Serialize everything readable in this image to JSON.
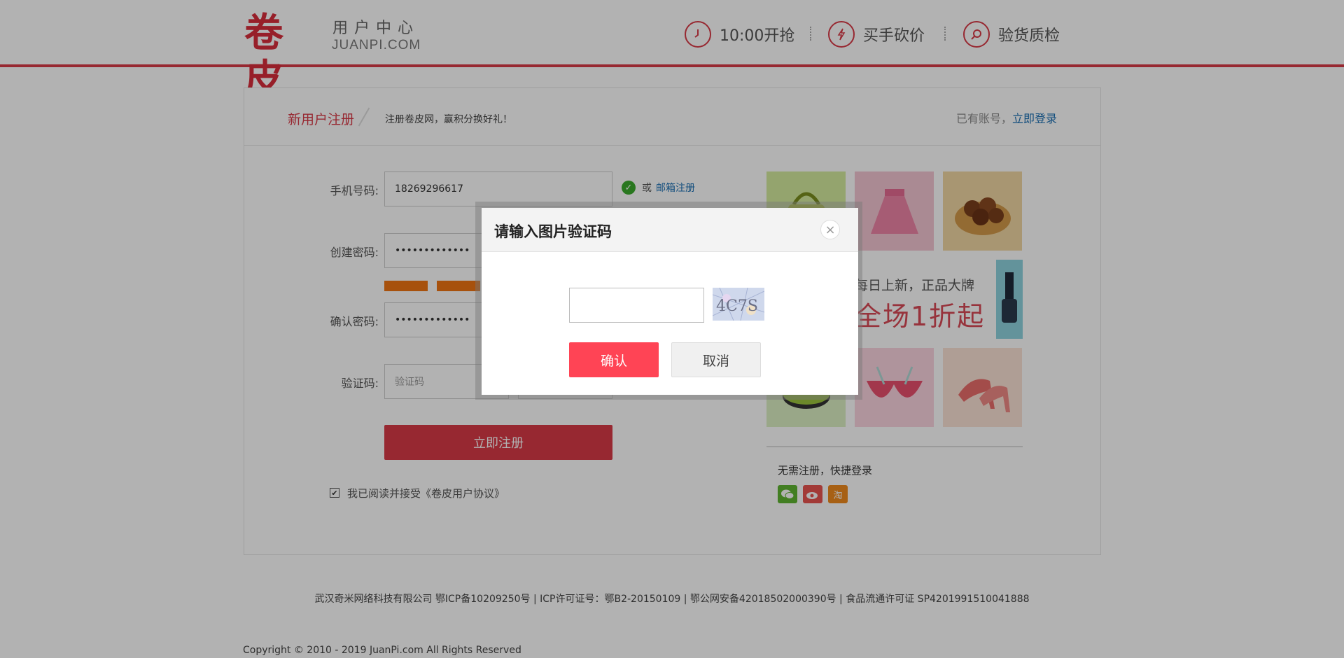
{
  "header": {
    "logo_main": "卷皮",
    "logo_sub1": "用户中心",
    "logo_sub2": "JUANPI.COM",
    "nav": [
      {
        "label": "10:00开抢",
        "icon": "clock-icon"
      },
      {
        "label": "买手砍价",
        "icon": "lightning-icon"
      },
      {
        "label": "验货质检",
        "icon": "magnifier-icon"
      }
    ],
    "accent_color": "#d83a47"
  },
  "card": {
    "title": "新用户注册",
    "subtitle": "注册卷皮网，赢积分换好礼！",
    "have_account": "已有账号，",
    "login_link": "立即登录"
  },
  "form": {
    "phone_label": "手机号码:",
    "phone_value": "18269296617",
    "or_text": "或",
    "email_register": "邮箱注册",
    "password_label": "创建密码:",
    "password_value": "•••••••••••••",
    "confirm_label": "确认密码:",
    "confirm_value": "•••••••••••••",
    "captcha_label": "验证码:",
    "captcha_placeholder": "验证码",
    "submit_label": "立即注册",
    "agree_text": "我已阅读并接受《卷皮用户协议》",
    "agree_checked": true
  },
  "ad": {
    "banner_line1": "每日上新，正品大牌",
    "banner_line2": "全场1折起"
  },
  "quick_login": {
    "title": "无需注册，快捷登录",
    "items": [
      {
        "name": "wechat-icon",
        "color": "#5fb532"
      },
      {
        "name": "weibo-icon",
        "color": "#e8544f"
      },
      {
        "name": "taobao-icon",
        "color": "#f08a1d",
        "glyph": "淘"
      }
    ]
  },
  "footer": {
    "icp": "武汉奇米网络科技有限公司 鄂ICP备10209250号 | ICP许可证号：鄂B2-20150109 | 鄂公网安备42018502000390号 | 食品流通许可证 SP4201991510041888",
    "copyright": "Copyright © 2010 - 2019 JuanPi.com All Rights Reserved"
  },
  "modal": {
    "title": "请输入图片验证码",
    "captcha_text": "4C7S",
    "confirm_label": "确认",
    "cancel_label": "取消"
  }
}
